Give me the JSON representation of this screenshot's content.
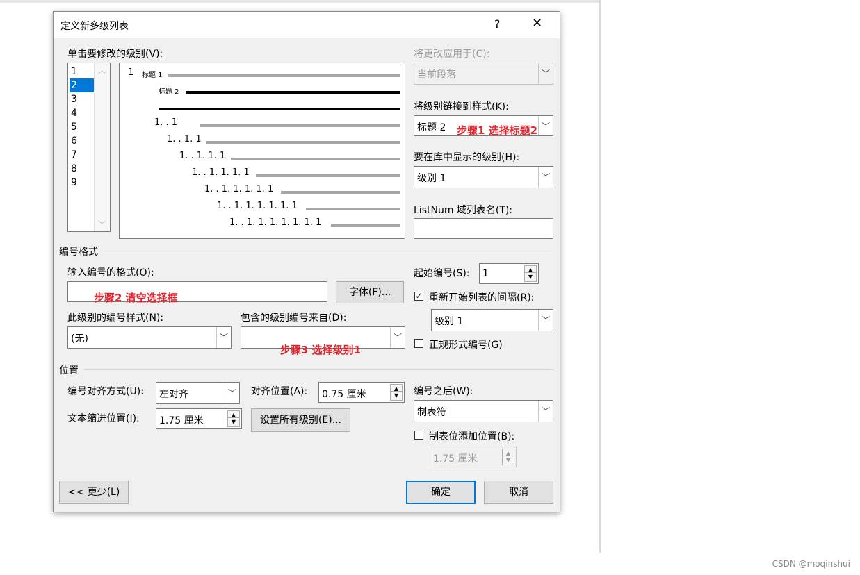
{
  "dialog": {
    "title": "定义新多级列表",
    "help": "?",
    "close": "✕"
  },
  "level": {
    "label": "单击要修改的级别(V):",
    "items": [
      "1",
      "2",
      "3",
      "4",
      "5",
      "6",
      "7",
      "8",
      "9"
    ],
    "selected": "2"
  },
  "preview": {
    "rows": [
      {
        "num": "1",
        "text": "标题 1",
        "style": "gray"
      },
      {
        "num": "",
        "text": "标题 2",
        "style": "black"
      },
      {
        "num": "",
        "text": "",
        "style": "black"
      },
      {
        "num": "1. . 1",
        "text": "",
        "style": "gray"
      },
      {
        "num": "1. . 1. 1",
        "text": "",
        "style": "gray"
      },
      {
        "num": "1. . 1. 1. 1",
        "text": "",
        "style": "gray"
      },
      {
        "num": "1. . 1. 1. 1. 1",
        "text": "",
        "style": "gray"
      },
      {
        "num": "1. . 1. 1. 1. 1. 1",
        "text": "",
        "style": "gray"
      },
      {
        "num": "1. . 1. 1. 1. 1. 1. 1",
        "text": "",
        "style": "gray"
      },
      {
        "num": "1. . 1. 1. 1. 1. 1. 1. 1",
        "text": "",
        "style": "gray"
      }
    ]
  },
  "apply_to": {
    "label": "将更改应用于(C):",
    "value": "当前段落"
  },
  "link_style": {
    "label": "将级别链接到样式(K):",
    "value": "标题 2"
  },
  "gallery_level": {
    "label": "要在库中显示的级别(H):",
    "value": "级别 1"
  },
  "listnum": {
    "label": "ListNum 域列表名(T):",
    "value": ""
  },
  "number_format": {
    "section": "编号格式",
    "format_label": "输入编号的格式(O):",
    "format_value": "",
    "font_button": "字体(F)...",
    "style_label": "此级别的编号样式(N):",
    "style_value": "(无)",
    "include_label": "包含的级别编号来自(D):",
    "include_value": ""
  },
  "start_at": {
    "label": "起始编号(S):",
    "value": "1"
  },
  "restart": {
    "label": "重新开始列表的间隔(R):",
    "checked": "✓",
    "value": "级别 1"
  },
  "legal": {
    "label": "正规形式编号(G)"
  },
  "position": {
    "section": "位置",
    "align_label": "编号对齐方式(U):",
    "align_value": "左对齐",
    "at_label": "对齐位置(A):",
    "at_value": "0.75 厘米",
    "indent_label": "文本缩进位置(I):",
    "indent_value": "1.75 厘米",
    "set_all_button": "设置所有级别(E)..."
  },
  "follow": {
    "label": "编号之后(W):",
    "value": "制表符"
  },
  "tabstop": {
    "label": "制表位添加位置(B):",
    "value": "1.75 厘米"
  },
  "buttons": {
    "less": "<< 更少(L)",
    "ok": "确定",
    "cancel": "取消"
  },
  "annotations": {
    "step1": "步骤1 选择标题2",
    "step2": "步骤2  清空选择框",
    "step3": "步骤3  选择级别1"
  },
  "watermark": "CSDN @moqinshui"
}
